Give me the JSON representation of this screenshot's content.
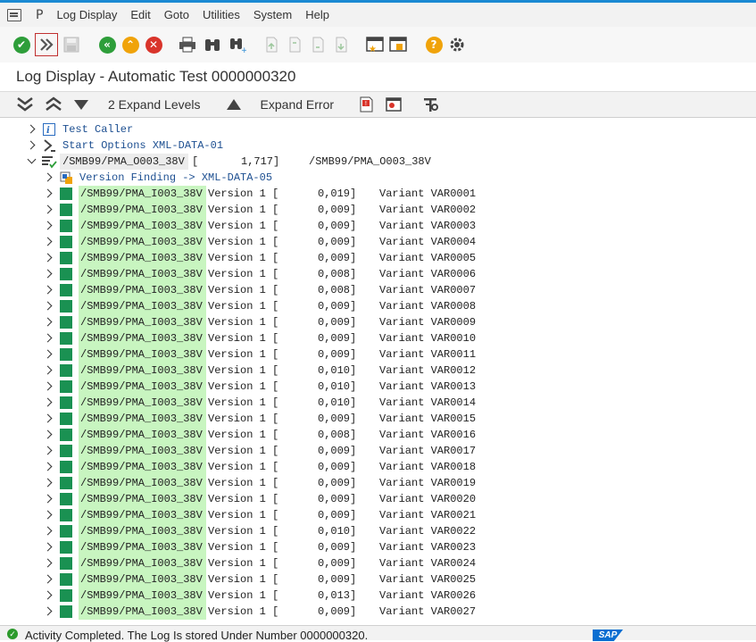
{
  "menubar": {
    "p_glyph": "P",
    "items": [
      "Log Display",
      "Edit",
      "Goto",
      "Utilities",
      "System",
      "Help"
    ]
  },
  "title": "Log Display - Automatic Test 0000000320",
  "subtoolbar": {
    "expand_levels": "2 Expand Levels",
    "expand_error": "Expand Error"
  },
  "tree": {
    "test_caller": "Test Caller",
    "start_options": "Start Options XML-DATA-01",
    "program_node": {
      "name": "/SMB99/PMA_O003_38V",
      "bracket": "[",
      "runtime": "1,717]",
      "name2": "/SMB99/PMA_O003_38V"
    },
    "version_finding": "Version Finding -> XML-DATA-05",
    "version_rows": [
      {
        "name": "/SMB99/PMA_I003_38V",
        "version": "Version 1 [",
        "time": "0,019]",
        "variant": "Variant VAR0001"
      },
      {
        "name": "/SMB99/PMA_I003_38V",
        "version": "Version 1 [",
        "time": "0,009]",
        "variant": "Variant VAR0002"
      },
      {
        "name": "/SMB99/PMA_I003_38V",
        "version": "Version 1 [",
        "time": "0,009]",
        "variant": "Variant VAR0003"
      },
      {
        "name": "/SMB99/PMA_I003_38V",
        "version": "Version 1 [",
        "time": "0,009]",
        "variant": "Variant VAR0004"
      },
      {
        "name": "/SMB99/PMA_I003_38V",
        "version": "Version 1 [",
        "time": "0,009]",
        "variant": "Variant VAR0005"
      },
      {
        "name": "/SMB99/PMA_I003_38V",
        "version": "Version 1 [",
        "time": "0,008]",
        "variant": "Variant VAR0006"
      },
      {
        "name": "/SMB99/PMA_I003_38V",
        "version": "Version 1 [",
        "time": "0,008]",
        "variant": "Variant VAR0007"
      },
      {
        "name": "/SMB99/PMA_I003_38V",
        "version": "Version 1 [",
        "time": "0,009]",
        "variant": "Variant VAR0008"
      },
      {
        "name": "/SMB99/PMA_I003_38V",
        "version": "Version 1 [",
        "time": "0,009]",
        "variant": "Variant VAR0009"
      },
      {
        "name": "/SMB99/PMA_I003_38V",
        "version": "Version 1 [",
        "time": "0,009]",
        "variant": "Variant VAR0010"
      },
      {
        "name": "/SMB99/PMA_I003_38V",
        "version": "Version 1 [",
        "time": "0,009]",
        "variant": "Variant VAR0011"
      },
      {
        "name": "/SMB99/PMA_I003_38V",
        "version": "Version 1 [",
        "time": "0,010]",
        "variant": "Variant VAR0012"
      },
      {
        "name": "/SMB99/PMA_I003_38V",
        "version": "Version 1 [",
        "time": "0,010]",
        "variant": "Variant VAR0013"
      },
      {
        "name": "/SMB99/PMA_I003_38V",
        "version": "Version 1 [",
        "time": "0,010]",
        "variant": "Variant VAR0014"
      },
      {
        "name": "/SMB99/PMA_I003_38V",
        "version": "Version 1 [",
        "time": "0,009]",
        "variant": "Variant VAR0015"
      },
      {
        "name": "/SMB99/PMA_I003_38V",
        "version": "Version 1 [",
        "time": "0,008]",
        "variant": "Variant VAR0016"
      },
      {
        "name": "/SMB99/PMA_I003_38V",
        "version": "Version 1 [",
        "time": "0,009]",
        "variant": "Variant VAR0017"
      },
      {
        "name": "/SMB99/PMA_I003_38V",
        "version": "Version 1 [",
        "time": "0,009]",
        "variant": "Variant VAR0018"
      },
      {
        "name": "/SMB99/PMA_I003_38V",
        "version": "Version 1 [",
        "time": "0,009]",
        "variant": "Variant VAR0019"
      },
      {
        "name": "/SMB99/PMA_I003_38V",
        "version": "Version 1 [",
        "time": "0,009]",
        "variant": "Variant VAR0020"
      },
      {
        "name": "/SMB99/PMA_I003_38V",
        "version": "Version 1 [",
        "time": "0,009]",
        "variant": "Variant VAR0021"
      },
      {
        "name": "/SMB99/PMA_I003_38V",
        "version": "Version 1 [",
        "time": "0,010]",
        "variant": "Variant VAR0022"
      },
      {
        "name": "/SMB99/PMA_I003_38V",
        "version": "Version 1 [",
        "time": "0,009]",
        "variant": "Variant VAR0023"
      },
      {
        "name": "/SMB99/PMA_I003_38V",
        "version": "Version 1 [",
        "time": "0,009]",
        "variant": "Variant VAR0024"
      },
      {
        "name": "/SMB99/PMA_I003_38V",
        "version": "Version 1 [",
        "time": "0,009]",
        "variant": "Variant VAR0025"
      },
      {
        "name": "/SMB99/PMA_I003_38V",
        "version": "Version 1 [",
        "time": "0,013]",
        "variant": "Variant VAR0026"
      },
      {
        "name": "/SMB99/PMA_I003_38V",
        "version": "Version 1 [",
        "time": "0,009]",
        "variant": "Variant VAR0027"
      }
    ]
  },
  "status": {
    "message": "Activity Completed. The Log Is stored Under Number 0000000320.",
    "logo": "SAP"
  },
  "colors": {
    "accent_blue": "#1b8ad3",
    "success_green": "#1a9152",
    "highlight_green": "#c8f5c0",
    "link_blue": "#1d4f91"
  }
}
